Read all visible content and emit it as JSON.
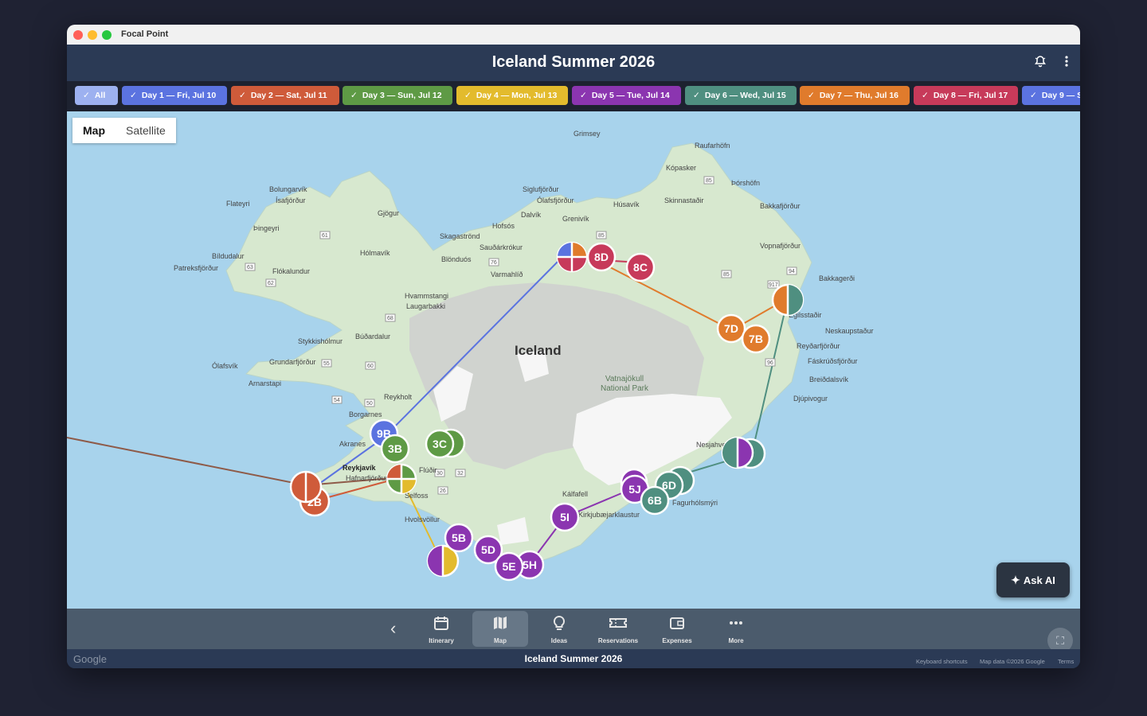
{
  "window": {
    "app_name": "Focal Point"
  },
  "header": {
    "title": "Iceland Summer 2026",
    "bell_icon": "bell-icon",
    "menu_icon": "more-vertical-icon"
  },
  "filters": [
    {
      "label": "All",
      "color": "#9db1f0"
    },
    {
      "label": "Day 1 — Fri, Jul 10",
      "color": "#5b73e0"
    },
    {
      "label": "Day 2 — Sat, Jul 11",
      "color": "#cf5b3a"
    },
    {
      "label": "Day 3 — Sun, Jul 12",
      "color": "#5e9a45"
    },
    {
      "label": "Day 4 — Mon, Jul 13",
      "color": "#e3bb2d"
    },
    {
      "label": "Day 5 — Tue, Jul 14",
      "color": "#8b35b0"
    },
    {
      "label": "Day 6 — Wed, Jul 15",
      "color": "#4f8f80"
    },
    {
      "label": "Day 7 — Thu, Jul 16",
      "color": "#e07b2c"
    },
    {
      "label": "Day 8 — Fri, Jul 17",
      "color": "#c73a5a"
    },
    {
      "label": "Day 9 — Sat, Jul 18",
      "color": "#5b73e0"
    }
  ],
  "map": {
    "type_options": [
      "Map",
      "Satellite"
    ],
    "selected_type": "Map",
    "country_label": "Iceland",
    "park_label": "Vatnajökull National Park",
    "places": [
      "Grimsey",
      "Raufarhöfn",
      "Kópasker",
      "Þórshöfn",
      "Bolungarvík",
      "Ísafjörður",
      "Flateyri",
      "Siglufjörður",
      "Ólafsfjörður",
      "Dalvík",
      "Grenivík",
      "Húsavík",
      "Skinnastaðir",
      "Bakkafjörður",
      "Gjögur",
      "Þingeyri",
      "Hofsós",
      "Skagaströnd",
      "Sauðárkrókur",
      "Hólmavík",
      "Bíldudalur",
      "Patreksfjörður",
      "Flókalundur",
      "Blönduós",
      "Varmahlíð",
      "Vopnafjörður",
      "Bakkagerði",
      "Hvammstangi",
      "Laugarbakki",
      "Egilsstaðir",
      "Neskaupstaður",
      "Stykkishólmur",
      "Búðardalur",
      "Reyðarfjörður",
      "Fáskrúðsfjörður",
      "Ólafsvík",
      "Grundarfjörður",
      "Breiðdalsvík",
      "Arnarstapi",
      "Reykholt",
      "Djúpivogur",
      "Borgarnes",
      "Akranes",
      "Reykjavík",
      "Hafnarfjörður",
      "Flúðir",
      "Selfoss",
      "Nesjahverfi",
      "Kálfafell",
      "Kirkjubæjarklaustur",
      "Fagurhólsmýri",
      "Hvolsvöllur"
    ],
    "markers": [
      "9B",
      "3B",
      "3C",
      "2B",
      "5B",
      "5D",
      "5E",
      "5H",
      "5I",
      "5J",
      "6D",
      "6B",
      "7D",
      "7B",
      "8D",
      "8C"
    ],
    "ask_ai_label": "Ask AI",
    "google_label": "Google",
    "attribution": [
      "Keyboard shortcuts",
      "Map data ©2026 Google",
      "Terms"
    ]
  },
  "nav": {
    "items": [
      {
        "label": "Itinerary",
        "icon": "calendar-icon"
      },
      {
        "label": "Map",
        "icon": "map-icon"
      },
      {
        "label": "Ideas",
        "icon": "lightbulb-icon"
      },
      {
        "label": "Reservations",
        "icon": "ticket-icon"
      },
      {
        "label": "Expenses",
        "icon": "wallet-icon"
      },
      {
        "label": "More",
        "icon": "more-horizontal-icon"
      }
    ],
    "active": "Map"
  },
  "footer": {
    "title": "Iceland Summer 2026"
  }
}
